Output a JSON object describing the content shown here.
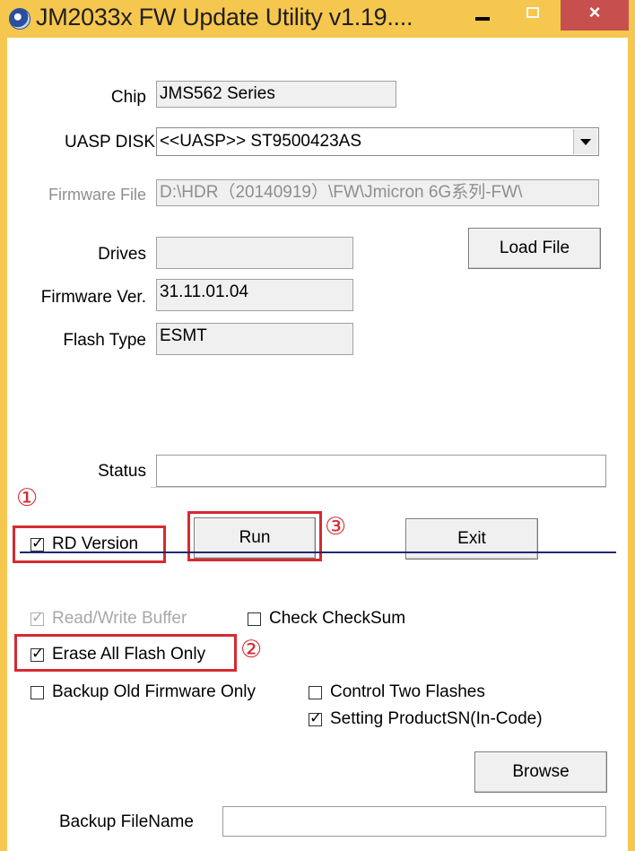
{
  "window": {
    "title": "JM2033x FW Update Utility v1.19....",
    "minimize_glyph": "minimize-icon",
    "maximize_glyph": "maximize-icon",
    "close_glyph": "×"
  },
  "form": {
    "chip": {
      "label": "Chip",
      "value": "JMS562 Series"
    },
    "uasp_disk": {
      "label": "UASP DISK",
      "value": "<<UASP>> ST9500423AS"
    },
    "firmware_file": {
      "label": "Firmware File",
      "value": "D:\\HDR（20140919）\\FW\\Jmicron 6G系列-FW\\"
    },
    "drives": {
      "label": "Drives",
      "value": ""
    },
    "firmware_ver": {
      "label": "Firmware Ver.",
      "value": "31.11.01.04"
    },
    "flash_type": {
      "label": "Flash Type",
      "value": "ESMT"
    },
    "status": {
      "label": "Status",
      "value": ""
    },
    "backup_filename": {
      "label": "Backup FileName",
      "value": ""
    }
  },
  "buttons": {
    "load_file": "Load File",
    "run": "Run",
    "exit": "Exit",
    "browse": "Browse"
  },
  "checkboxes": {
    "rd_version": {
      "label": "RD Version",
      "checked": true
    },
    "read_write_buffer": {
      "label": "Read/Write Buffer",
      "checked": true,
      "disabled": true
    },
    "check_checksum": {
      "label": "Check CheckSum",
      "checked": false
    },
    "erase_all_flash_only": {
      "label": "Erase All Flash Only",
      "checked": true
    },
    "backup_old_firmware_only": {
      "label": "Backup Old Firmware Only",
      "checked": false
    },
    "control_two_flashes": {
      "label": "Control Two Flashes",
      "checked": false
    },
    "setting_product_sn": {
      "label": "Setting ProductSN(In-Code)",
      "checked": true
    }
  },
  "annotations": {
    "step1": "①",
    "step2": "②",
    "step3": "③",
    "highlight_color": "#d62a31"
  },
  "colors": {
    "titlebar": "#F6C74F",
    "close_button": "#C7504F",
    "divider": "#1e2a72"
  }
}
